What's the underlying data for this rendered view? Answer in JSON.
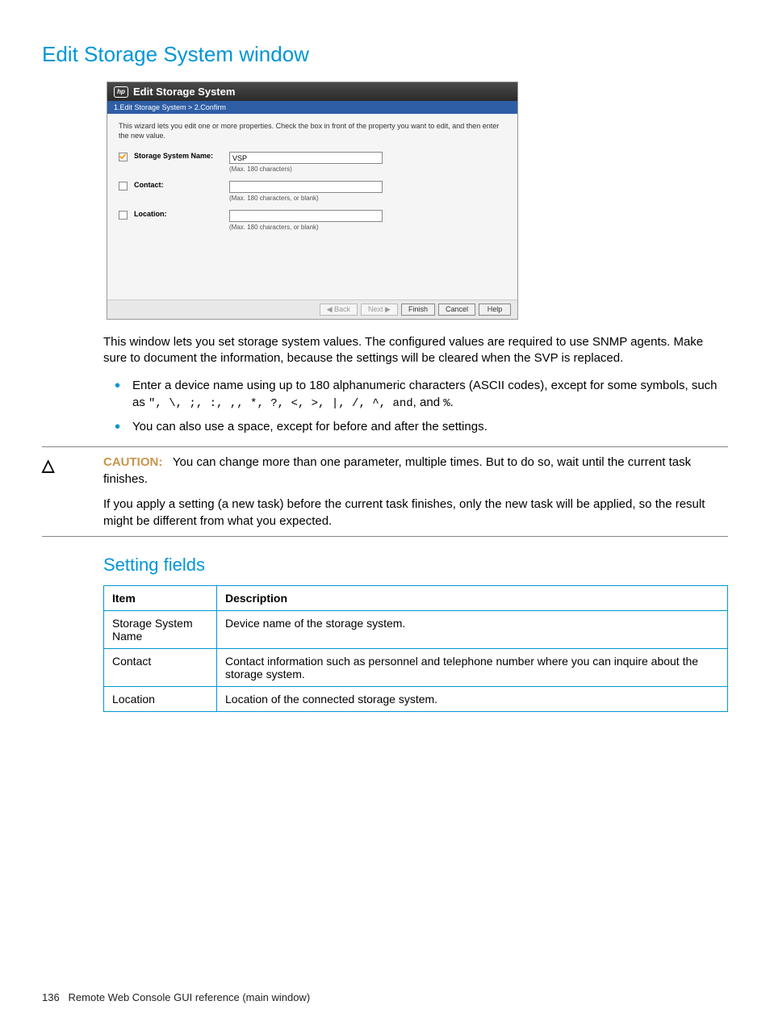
{
  "page_title": "Edit Storage System window",
  "screenshot": {
    "window_title": "Edit Storage System",
    "breadcrumb": "1.Edit Storage System  >  2.Confirm",
    "instruction": "This wizard lets you edit one or more properties. Check the  box in front of the property you want to edit, and then enter the new value.",
    "rows": [
      {
        "checked": true,
        "label": "Storage System Name:",
        "value": "VSP",
        "hint": "(Max. 180 characters)"
      },
      {
        "checked": false,
        "label": "Contact:",
        "value": "",
        "hint": "(Max. 180 characters, or blank)"
      },
      {
        "checked": false,
        "label": "Location:",
        "value": "",
        "hint": "(Max. 180 characters, or blank)"
      }
    ],
    "buttons": {
      "back": "◀ Back",
      "next": "Next ▶",
      "finish": "Finish",
      "cancel": "Cancel",
      "help": "Help"
    }
  },
  "para_intro": "This window lets you set storage system values. The configured values are required to use SNMP agents. Make sure to document the information, because the settings will be cleared when the SVP is replaced.",
  "bullets": {
    "b1_pre": "Enter a device name using up to 180 alphanumeric characters (ASCII codes), except for some symbols, such as ",
    "b1_sym": "\", \\, ;, :, ,, *, ?, <, >, |, /, ^, and",
    "b1_post": ", and ",
    "b1_pct": "%",
    "b1_end": ".",
    "b2": "You can also use a space, except for before and after the settings."
  },
  "caution": {
    "label": "CAUTION:",
    "line1": "You can change more than one parameter, multiple times. But to do so, wait until the current task finishes.",
    "line2": "If you apply a setting (a new task) before the current task finishes, only the new task will be applied, so the result might be different from what you expected."
  },
  "setting_fields": {
    "heading": "Setting fields",
    "head_item": "Item",
    "head_desc": "Description",
    "rows": [
      {
        "item": "Storage System Name",
        "desc": "Device name of the storage system."
      },
      {
        "item": "Contact",
        "desc": "Contact information such as personnel and telephone number where you can inquire about the storage system."
      },
      {
        "item": "Location",
        "desc": "Location of the connected storage system."
      }
    ]
  },
  "footer": {
    "page_no": "136",
    "chapter": "Remote Web Console GUI reference (main window)"
  }
}
